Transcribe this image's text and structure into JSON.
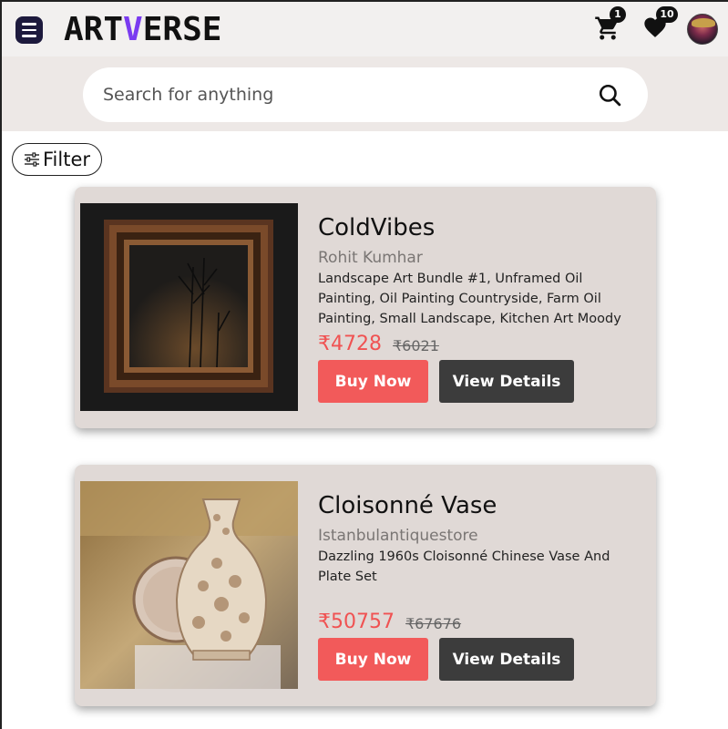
{
  "header": {
    "logo_prefix": "ART",
    "logo_accent": "V",
    "logo_suffix": "ERSE",
    "cart_count": "1",
    "wishlist_count": "10"
  },
  "search": {
    "placeholder": "Search for anything"
  },
  "filter": {
    "label": "Filter"
  },
  "products": [
    {
      "title": "ColdVibes",
      "artist": "Rohit Kumhar",
      "description": "Landscape Art Bundle #1, Unframed Oil Painting, Oil Painting Countryside, Farm Oil Painting, Small Landscape, Kitchen Art Moody",
      "price": "₹4728",
      "original_price": "₹6021",
      "buy_label": "Buy Now",
      "details_label": "View Details"
    },
    {
      "title": "Cloisonné Vase",
      "artist": "Istanbulantiquestore",
      "description": "Dazzling 1960s Cloisonné Chinese Vase And Plate Set",
      "price": "₹50757",
      "original_price": "₹67676",
      "buy_label": "Buy Now",
      "details_label": "View Details"
    }
  ],
  "colors": {
    "accent": "#7a3bf0",
    "buy_button": "#f25a5a",
    "details_button": "#3c3c3c",
    "price": "#f05252",
    "card_background": "#e0d9d6"
  }
}
